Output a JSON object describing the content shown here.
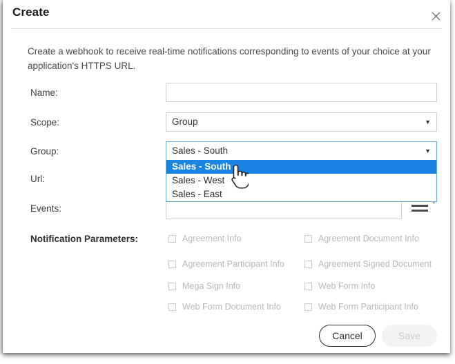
{
  "dialog": {
    "title": "Create",
    "close_icon": "close-icon",
    "intro": "Create a webhook to receive real-time notifications corresponding to events of your choice at your application's HTTPS URL."
  },
  "form": {
    "name": {
      "label": "Name:",
      "value": "",
      "placeholder": ""
    },
    "scope": {
      "label": "Scope:",
      "value": "Group",
      "caret": "▼"
    },
    "group": {
      "label": "Group:",
      "value": "Sales - South",
      "caret": "▼",
      "options": [
        {
          "label": "Sales - South",
          "selected": true
        },
        {
          "label": "Sales - West",
          "selected": false
        },
        {
          "label": "Sales - East",
          "selected": false
        }
      ]
    },
    "url": {
      "label": "Url:",
      "value": ""
    },
    "events": {
      "label": "Events:",
      "value": "",
      "menu_icon": "hamburger-menu-icon",
      "caret": "▼"
    }
  },
  "notification_parameters": {
    "label": "Notification Parameters:",
    "items": [
      {
        "label": "Agreement Info",
        "checked": false,
        "disabled": true
      },
      {
        "label": "Agreement Document Info",
        "checked": false,
        "disabled": true
      },
      {
        "label": "Agreement Participant Info",
        "checked": false,
        "disabled": true
      },
      {
        "label": "Agreement Signed Document",
        "checked": false,
        "disabled": true
      },
      {
        "label": "Mega Sign Info",
        "checked": false,
        "disabled": true
      },
      {
        "label": "Web Form Info",
        "checked": false,
        "disabled": true
      },
      {
        "label": "Web Form Document Info",
        "checked": false,
        "disabled": true
      },
      {
        "label": "Web Form Participant Info",
        "checked": false,
        "disabled": true
      }
    ]
  },
  "footer": {
    "cancel_label": "Cancel",
    "save_label": "Save",
    "save_disabled": true
  },
  "pointer": {
    "icon": "hand-pointer-cursor"
  },
  "colors": {
    "highlight_blue": "#1a84e2",
    "focus_border": "#6aa6d8",
    "disabled_text": "#b8b8b8",
    "dialog_bg": "#ffffff"
  }
}
